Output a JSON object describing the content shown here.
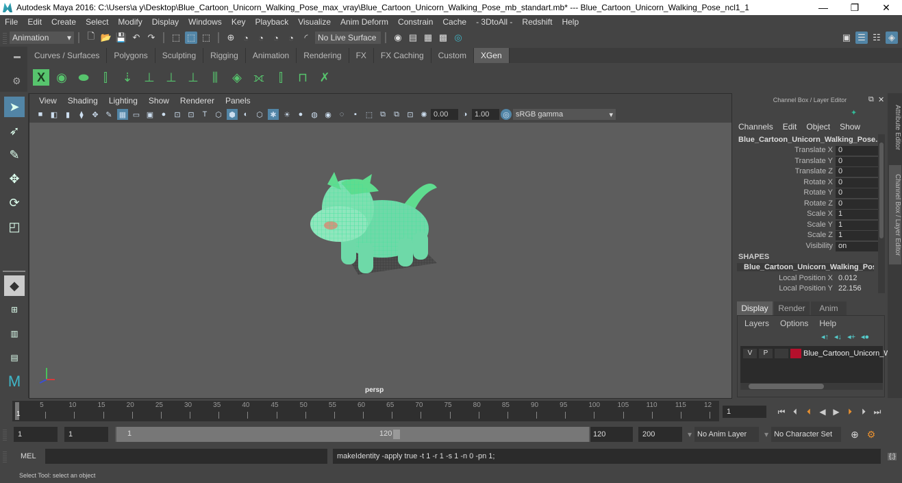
{
  "titlebar": {
    "title": "Autodesk Maya 2016: C:\\Users\\a y\\Desktop\\Blue_Cartoon_Unicorn_Walking_Pose_max_vray\\Blue_Cartoon_Unicorn_Walking_Pose_mb_standart.mb*  ---  Blue_Cartoon_Unicorn_Walking_Pose_ncl1_1",
    "minimize": "—",
    "maximize": "❐",
    "close": "✕"
  },
  "menubar": [
    "File",
    "Edit",
    "Create",
    "Select",
    "Modify",
    "Display",
    "Windows",
    "Key",
    "Playback",
    "Visualize",
    "Anim Deform",
    "Constrain",
    "Cache",
    "- 3DtoAll -",
    "Redshift",
    "Help"
  ],
  "statusline": {
    "menuset": "Animation",
    "live_surface": "No Live Surface"
  },
  "shelf": {
    "tabs": [
      "Curves / Surfaces",
      "Polygons",
      "Sculpting",
      "Rigging",
      "Animation",
      "Rendering",
      "FX",
      "FX Caching",
      "Custom",
      "XGen"
    ],
    "selected_tab": "XGen",
    "icons": [
      "xgen-description-editor-icon",
      "xgen-preview-icon",
      "xgen-clear-preview-icon",
      "xgen-add-guides-icon",
      "xgen-place-guides-icon",
      "xgen-add-guide-icon",
      "xgen-sculpt-guide-icon",
      "xgen-lock-guide-icon",
      "xgen-guide-length-icon",
      "xgen-patch-icon",
      "xgen-bend-guide-icon",
      "xgen-select-guide-icon",
      "xgen-guide-region-icon",
      "xgen-delete-guide-icon"
    ]
  },
  "viewport": {
    "menus": [
      "View",
      "Shading",
      "Lighting",
      "Show",
      "Renderer",
      "Panels"
    ],
    "exposure": "0.00",
    "gamma": "1.00",
    "color_space": "sRGB gamma",
    "camera_label": "persp"
  },
  "channel_box": {
    "title": "Channel Box / Layer Editor",
    "menus": [
      "Channels",
      "Edit",
      "Object",
      "Show"
    ],
    "object_name": "Blue_Cartoon_Unicorn_Walking_Pose...",
    "channels": [
      {
        "label": "Translate X",
        "value": "0"
      },
      {
        "label": "Translate Y",
        "value": "0"
      },
      {
        "label": "Translate Z",
        "value": "0"
      },
      {
        "label": "Rotate X",
        "value": "0"
      },
      {
        "label": "Rotate Y",
        "value": "0"
      },
      {
        "label": "Rotate Z",
        "value": "0"
      },
      {
        "label": "Scale X",
        "value": "1"
      },
      {
        "label": "Scale Y",
        "value": "1"
      },
      {
        "label": "Scale Z",
        "value": "1"
      },
      {
        "label": "Visibility",
        "value": "on"
      }
    ],
    "shapes_heading": "SHAPES",
    "shape_name": "Blue_Cartoon_Unicorn_Walking_Pos...",
    "shape_channels": [
      {
        "label": "Local Position X",
        "value": "0.012"
      },
      {
        "label": "Local Position Y",
        "value": "22.156"
      }
    ]
  },
  "layer_editor": {
    "tabs": [
      "Display",
      "Render",
      "Anim"
    ],
    "selected_tab": "Display",
    "menus": [
      "Layers",
      "Options",
      "Help"
    ],
    "layer": {
      "v": "V",
      "p": "P",
      "name": "Blue_Cartoon_Unicorn_W",
      "color": "#b5102c"
    }
  },
  "side_tabs": [
    "Attribute Editor",
    "Channel Box / Layer Editor"
  ],
  "timeslider": {
    "ticks": [
      5,
      10,
      15,
      20,
      25,
      30,
      35,
      40,
      45,
      50,
      55,
      60,
      65,
      70,
      75,
      80,
      85,
      90,
      95,
      100,
      105,
      110,
      115,
      "12"
    ],
    "current_frame_marker": "1",
    "current_frame": "1"
  },
  "range": {
    "start": "1",
    "playback_start": "1",
    "slider_start": "1",
    "slider_end": "120",
    "playback_end": "120",
    "end": "200",
    "anim_layer": "No Anim Layer",
    "character_set": "No Character Set"
  },
  "command_line": {
    "label": "MEL",
    "input": "",
    "result": "makeIdentity -apply true -t 1 -r 1 -s 1 -n 0 -pn 1;"
  },
  "help_line": "Select Tool: select an object"
}
